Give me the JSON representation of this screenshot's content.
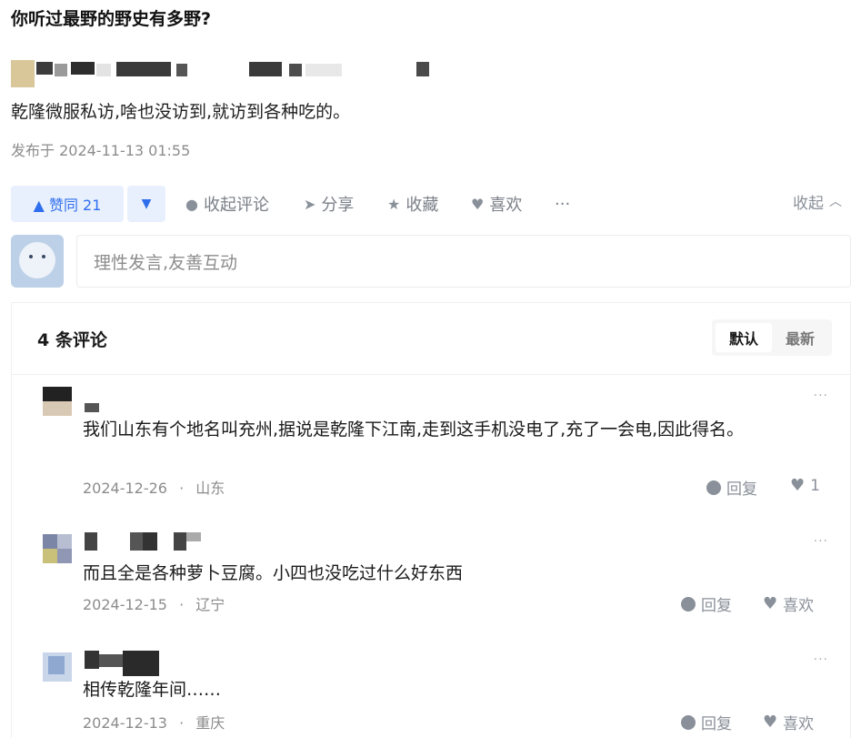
{
  "question": {
    "title": "你听过最野的野史有多野?"
  },
  "answer": {
    "content": "乾隆微服私访,啥也没访到,就访到各种吃的。",
    "published": "发布于 2024-11-13 01:55"
  },
  "actions": {
    "upvote": "▲ 赞同 21",
    "downvote": "▼",
    "comment_toggle": "收起评论",
    "share": "分享",
    "collect": "收藏",
    "like": "喜欢",
    "more": "···",
    "collapse": "收起"
  },
  "comment_input": {
    "placeholder": "理性发言,友善互动"
  },
  "comments_section": {
    "count": "4 条评论",
    "sort_default": "默认",
    "sort_latest": "最新",
    "items": [
      {
        "text": "我们山东有个地名叫充州,据说是乾隆下江南,走到这手机没电了,充了一会电,因此得名。",
        "date": "2024-12-26",
        "location": "山东",
        "reply": "回复",
        "likes": "1",
        "more": "···"
      },
      {
        "text": "而且全是各种萝卜豆腐。小四也没吃过什么好东西",
        "date": "2024-12-15",
        "location": "辽宁",
        "reply": "回复",
        "like_label": "喜欢",
        "more": "···"
      },
      {
        "text": "相传乾隆年间……",
        "date": "2024-12-13",
        "location": "重庆",
        "reply": "回复",
        "like_label": "喜欢",
        "more": "···"
      }
    ]
  },
  "meta_separator": "·",
  "colors": {
    "accent": "#2f6fed",
    "accent_bg": "#e9f0fd",
    "muted": "#8c8c8c"
  }
}
